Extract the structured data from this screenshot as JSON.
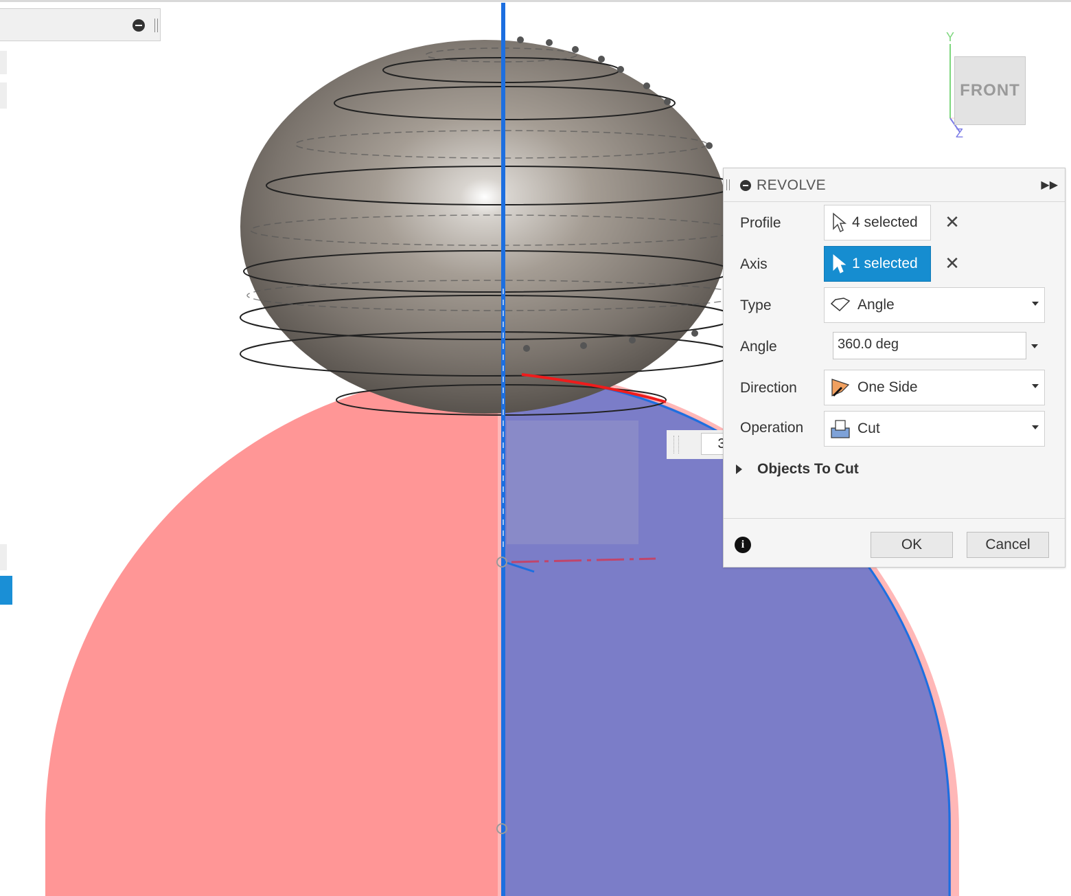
{
  "viewcube": {
    "face_label": "FRONT",
    "axis_y": "Y",
    "axis_z": "Z"
  },
  "dialog": {
    "title": "REVOLVE",
    "profile": {
      "label": "Profile",
      "value": "4 selected"
    },
    "axis": {
      "label": "Axis",
      "value": "1 selected"
    },
    "type": {
      "label": "Type",
      "value": "Angle"
    },
    "angle": {
      "label": "Angle",
      "value": "360.0 deg"
    },
    "direction": {
      "label": "Direction",
      "value": "One Side"
    },
    "operation": {
      "label": "Operation",
      "value": "Cut"
    },
    "objects_to_cut": "Objects To Cut",
    "ok": "OK",
    "cancel": "Cancel"
  },
  "dimension_input": {
    "value": "360.0 deg"
  },
  "colors": {
    "profile_red": "#ff9696",
    "profile_blue": "#7b7dc8",
    "axis_blue": "#1d6fe0",
    "accent": "#168dd0"
  }
}
